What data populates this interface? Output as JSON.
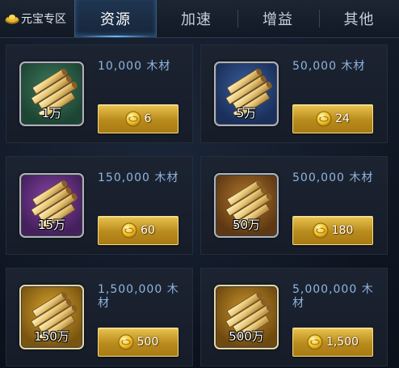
{
  "tabs": {
    "premium": {
      "label": "元宝专区",
      "icon": "gold-ingot-icon"
    },
    "items": [
      {
        "label": "资源",
        "active": true
      },
      {
        "label": "加速",
        "active": false
      },
      {
        "label": "增益",
        "active": false
      },
      {
        "label": "其他",
        "active": false
      }
    ]
  },
  "colors": {
    "accent_tab_glow": "#6fb8ff",
    "title_text": "#8fb5e0",
    "buy_button": "#e8c24e"
  },
  "items": [
    {
      "title": "10,000 木材",
      "icon_label": "1万",
      "quality": "green",
      "price": "6"
    },
    {
      "title": "50,000 木材",
      "icon_label": "5万",
      "quality": "blue",
      "price": "24"
    },
    {
      "title": "150,000 木材",
      "icon_label": "15万",
      "quality": "purple",
      "price": "60"
    },
    {
      "title": "500,000 木材",
      "icon_label": "50万",
      "quality": "orange",
      "price": "180"
    },
    {
      "title": "1,500,000 木材",
      "icon_label": "150万",
      "quality": "gold",
      "price": "500"
    },
    {
      "title": "5,000,000 木材",
      "icon_label": "500万",
      "quality": "gold",
      "price": "1,500"
    }
  ],
  "icons": {
    "item": "wood-logs-icon",
    "currency": "gold-coin-icon"
  }
}
